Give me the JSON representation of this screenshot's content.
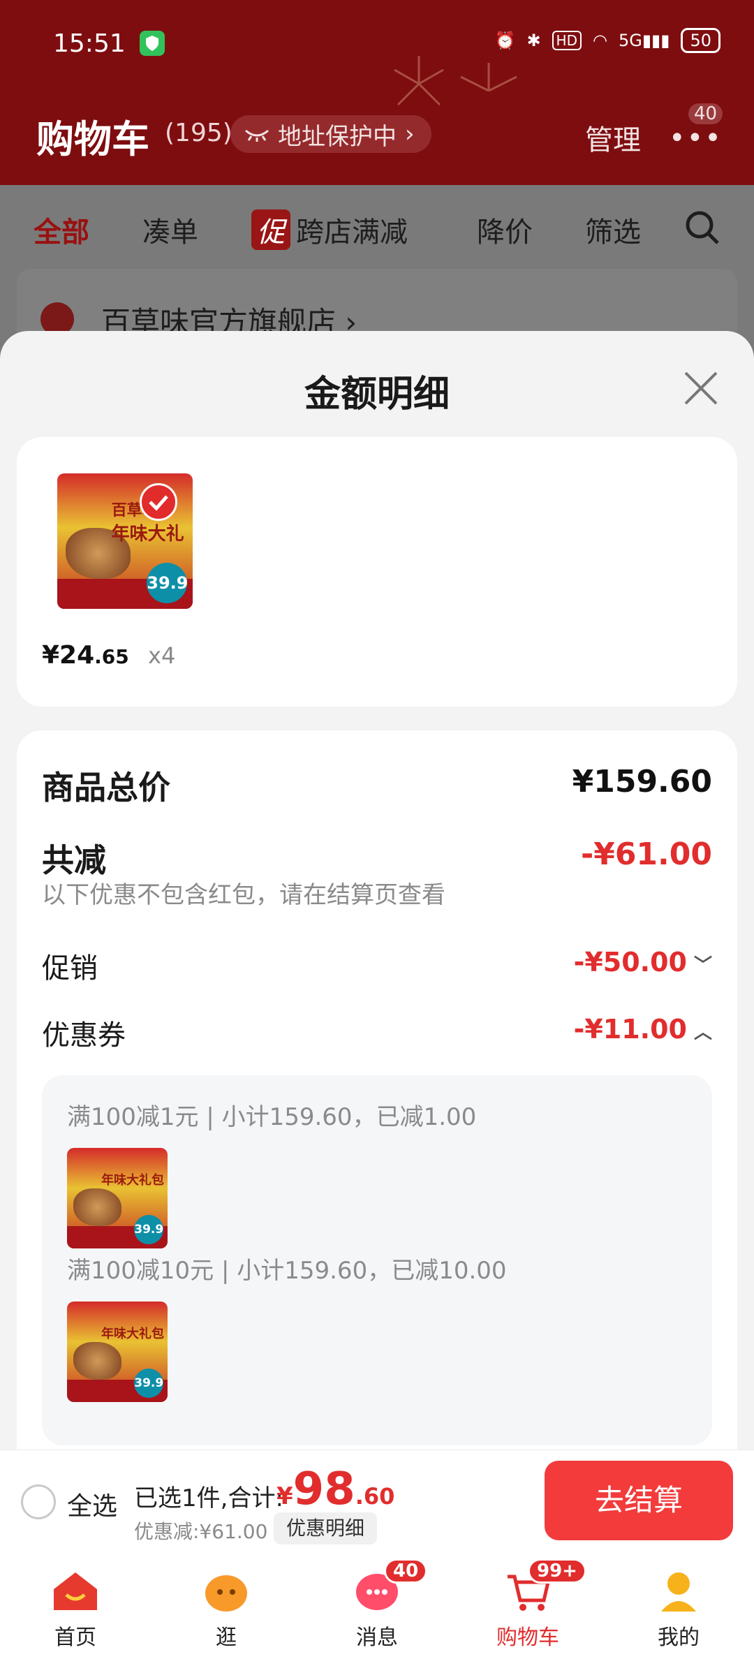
{
  "status_bar": {
    "time": "15:51",
    "network": "5G",
    "hd": "HD",
    "battery": "50"
  },
  "header": {
    "title": "购物车",
    "count": "(195)",
    "address_pill": "地址保护中",
    "manage": "管理",
    "more_badge": "40"
  },
  "filter_tabs": {
    "all": "全部",
    "bundle": "凑单",
    "promo_tag": "促",
    "cross_store": "跨店满减",
    "price_drop": "降价",
    "filter": "筛选"
  },
  "store": {
    "name": "百草味官方旗舰店"
  },
  "sheet": {
    "title": "金额明细",
    "item": {
      "price_int": "¥24",
      "price_dec": ".65",
      "qty": "x4",
      "thumb_brand": "百草味",
      "thumb_title": "年味大礼",
      "thumb_price": "39.9"
    },
    "total_label": "商品总价",
    "total_value": "¥159.60",
    "reduction_label": "共减",
    "reduction_value": "-¥61.00",
    "note": "以下优惠不包含红包，请在结算页查看",
    "promo_label": "促销",
    "promo_value": "-¥50.00",
    "coupon_label": "优惠券",
    "coupon_value": "-¥11.00",
    "coupons": [
      {
        "text": "满100减1元 | 小计159.60，已减1.00"
      },
      {
        "text": "满100减10元 | 小计159.60，已减10.00"
      }
    ],
    "coupon_thumb_title": "年味大礼包"
  },
  "bottom_bar": {
    "select_all": "全选",
    "selected_info": "已选1件,合计:",
    "total_symbol": "¥",
    "total_int": "98",
    "total_dec": ".60",
    "discount_info": "优惠减:¥61.00",
    "detail_button": "优惠明细",
    "checkout": "去结算"
  },
  "nav": {
    "items": [
      {
        "label": "首页"
      },
      {
        "label": "逛"
      },
      {
        "label": "消息",
        "badge": "40"
      },
      {
        "label": "购物车",
        "badge": "99+"
      },
      {
        "label": "我的"
      }
    ]
  },
  "colors": {
    "accent": "#e12d2d",
    "header_bg": "#7e0d10",
    "checkout_bg": "#f33b3b"
  }
}
